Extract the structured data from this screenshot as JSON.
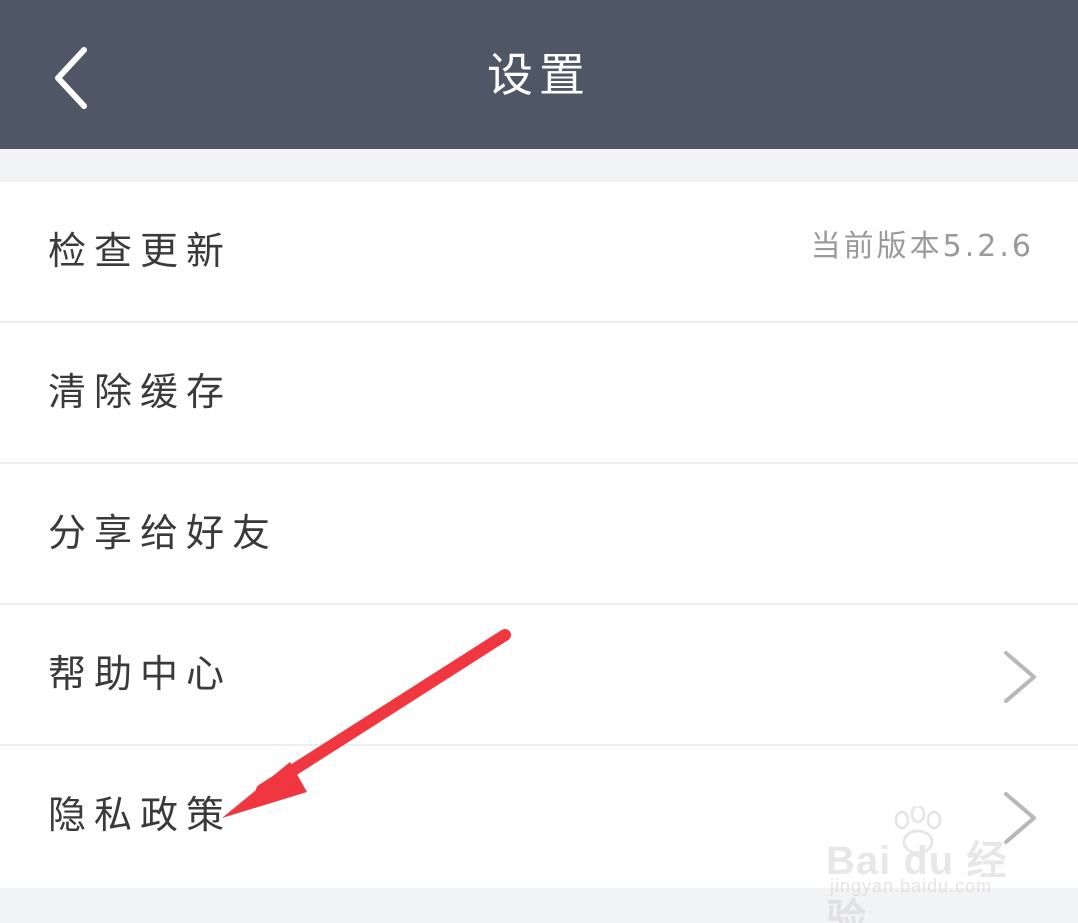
{
  "header": {
    "title": "设置",
    "back_icon": "chevron-left-icon"
  },
  "settings": {
    "items": [
      {
        "label": "检查更新",
        "value": "当前版本5.2.6",
        "has_chevron": false
      },
      {
        "label": "清除缓存",
        "value": "",
        "has_chevron": false
      },
      {
        "label": "分享给好友",
        "value": "",
        "has_chevron": false
      },
      {
        "label": "帮助中心",
        "value": "",
        "has_chevron": true
      },
      {
        "label": "隐私政策",
        "value": "",
        "has_chevron": true
      }
    ]
  },
  "annotation": {
    "color": "#f0373f",
    "icon": "red-arrow-pointer"
  },
  "watermark": {
    "brand": "Bai du 经验",
    "url": "jingyan.baidu.com"
  },
  "colors": {
    "navbar": "#4f5666",
    "background": "#f2f3f5",
    "row": "#ffffff",
    "label": "#3a3a3a",
    "secondary": "#9a9a9a"
  }
}
